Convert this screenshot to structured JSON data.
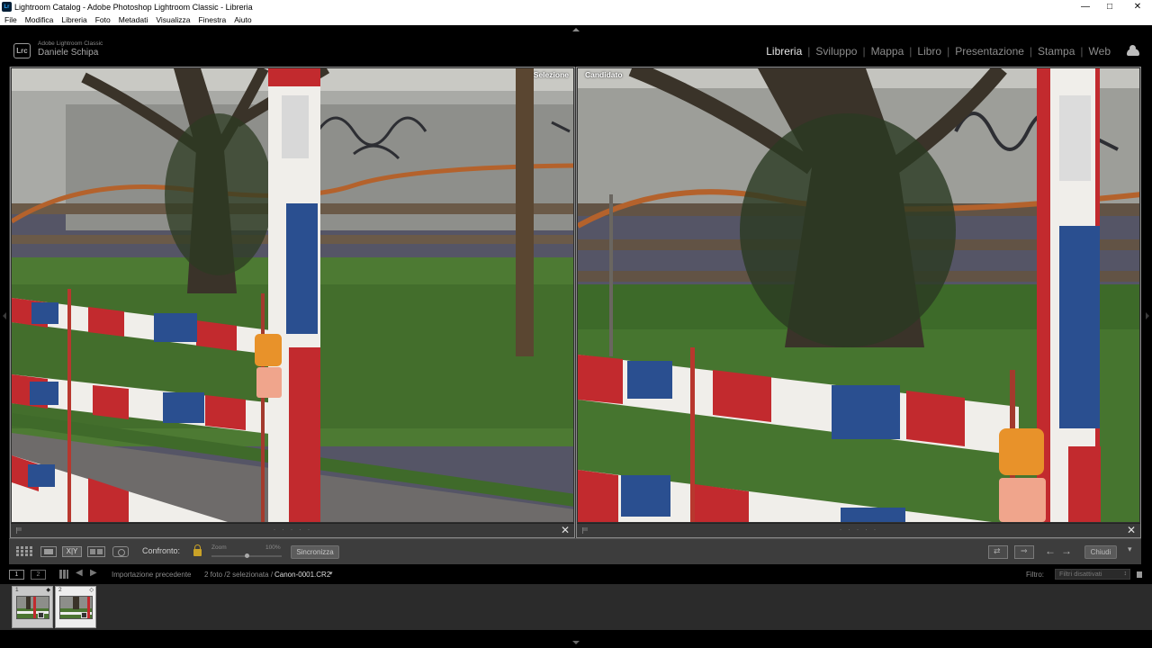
{
  "window": {
    "title": "Lightroom Catalog - Adobe Photoshop Lightroom Classic - Libreria",
    "app_icon": "Lr",
    "controls": {
      "minimize": "—",
      "maximize": "□",
      "close": "✕"
    }
  },
  "menu": [
    "File",
    "Modifica",
    "Libreria",
    "Foto",
    "Metadati",
    "Visualizza",
    "Finestra",
    "Aiuto"
  ],
  "identity": {
    "badge": "Lrc",
    "product": "Adobe Lightroom Classic",
    "user": "Daniele Schipa"
  },
  "modules": [
    {
      "label": "Libreria",
      "active": true
    },
    {
      "label": "Sviluppo",
      "active": false
    },
    {
      "label": "Mappa",
      "active": false
    },
    {
      "label": "Libro",
      "active": false
    },
    {
      "label": "Presentazione",
      "active": false
    },
    {
      "label": "Stampa",
      "active": false
    },
    {
      "label": "Web",
      "active": false
    }
  ],
  "compare": {
    "left": {
      "label": "Selezione",
      "stars": "· · · · ·",
      "close": "✕"
    },
    "right": {
      "label": "Candidato",
      "stars": "· · · · ·",
      "close": "✕"
    }
  },
  "toolbar": {
    "xy_label": "X|Y",
    "confronto_label": "Confronto:",
    "zoom_label": "Zoom",
    "zoom_value": "100%",
    "zoom_level": 0.5,
    "sync_label": "Sincronizza",
    "prev_arrow": "←",
    "next_arrow": "→",
    "close_label": "Chiudi",
    "menu_caret": "▾"
  },
  "filmstrip": {
    "monitor1": "1",
    "monitor2": "2",
    "back": "◀",
    "forward": "▶",
    "source": "Importazione precedente",
    "count": "2 foto /2 selezionata /",
    "filename": "Canon-0001.CR2",
    "caret": "▾",
    "filter_label": "Filtro:",
    "filter_value": "Filtri disattivati",
    "thumbnails": [
      {
        "num": "1",
        "corner": "◆"
      },
      {
        "num": "2",
        "corner": "◇"
      }
    ]
  }
}
